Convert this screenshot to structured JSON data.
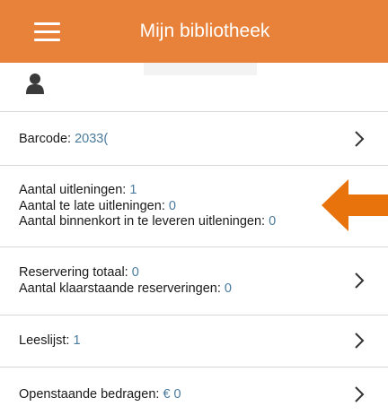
{
  "header": {
    "title": "Mijn bibliotheek",
    "menu_icon": "hamburger-menu-icon"
  },
  "user": {
    "icon": "user-icon"
  },
  "rows": [
    {
      "lines": [
        {
          "label": "Barcode:",
          "value": "2033("
        }
      ],
      "chevron": true
    },
    {
      "lines": [
        {
          "label": "Aantal uitleningen:",
          "value": "1"
        },
        {
          "label": "Aantal te late uitleningen:",
          "value": "0"
        },
        {
          "label": "Aantal binnenkort in te leveren uitleningen:",
          "value": "0"
        }
      ],
      "chevron": false
    },
    {
      "lines": [
        {
          "label": "Reservering totaal:",
          "value": "0"
        },
        {
          "label": "Aantal klaarstaande reserveringen:",
          "value": "0"
        }
      ],
      "chevron": true
    },
    {
      "lines": [
        {
          "label": "Leeslijst:",
          "value": "1"
        }
      ],
      "chevron": true
    },
    {
      "lines": [
        {
          "label": "Openstaande bedragen:",
          "value": "€ 0"
        }
      ],
      "chevron": true
    }
  ],
  "colors": {
    "accent": "#E8823A",
    "value_text": "#4a7a9c",
    "divider": "#d7d7d7"
  }
}
